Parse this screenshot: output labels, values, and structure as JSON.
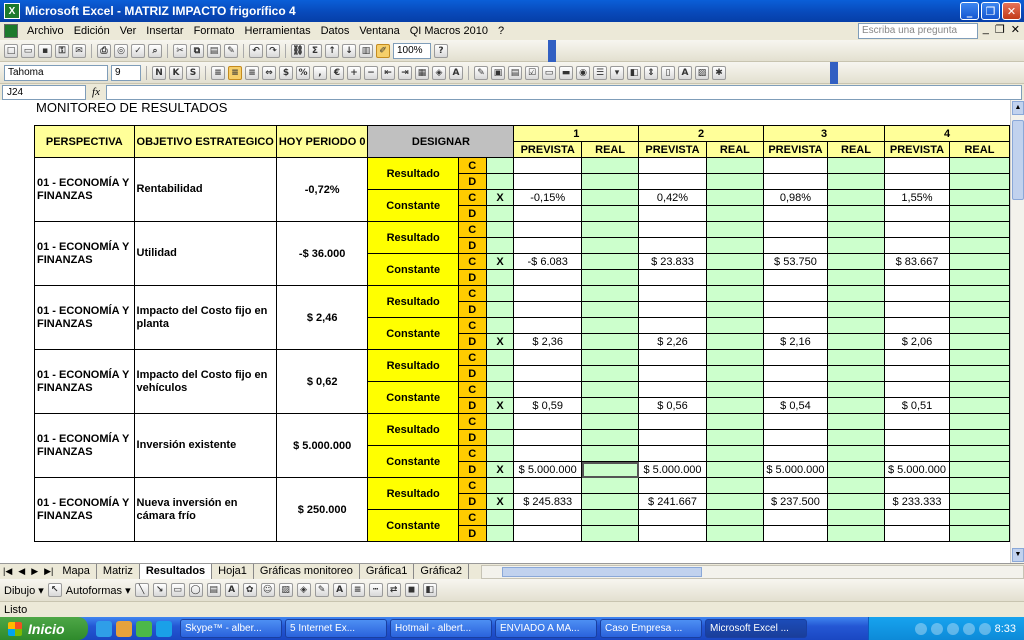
{
  "window": {
    "title": "Microsoft Excel - MATRIZ IMPACTO frigorífico 4"
  },
  "menu": {
    "items": [
      "Archivo",
      "Edición",
      "Ver",
      "Insertar",
      "Formato",
      "Herramientas",
      "Datos",
      "Ventana",
      "QI Macros 2010",
      "?"
    ],
    "help_placeholder": "Escriba una pregunta"
  },
  "toolbar": {
    "zoom": "100%",
    "font": "Tahoma",
    "font_size": "9"
  },
  "formula": {
    "cell_ref": "J24",
    "fx": "fx"
  },
  "sheet": {
    "title": "MONITOREO DE RESULTADOS",
    "headers": {
      "perspectiva": "PERSPECTIVA",
      "objetivo": "OBJETIVO ESTRATEGICO",
      "hoy": "HOY  PERIODO 0",
      "designar": "DESIGNAR",
      "periods": [
        "1",
        "2",
        "3",
        "4"
      ],
      "prevista": "PREVISTA",
      "real": "REAL"
    },
    "labels": {
      "resultado": "Resultado",
      "constante": "Constante",
      "c": "C",
      "d": "D",
      "x": "X"
    },
    "rows": [
      {
        "perspectiva": "01 - ECONOMÍA Y FINANZAS",
        "objetivo": "Rentabilidad",
        "hoy": "-0,72%",
        "mark_row": 2,
        "values": [
          "-0,15%",
          "0,42%",
          "0,98%",
          "1,55%"
        ]
      },
      {
        "perspectiva": "01 - ECONOMÍA Y FINANZAS",
        "objetivo": "Utilidad",
        "hoy": "-$ 36.000",
        "mark_row": 2,
        "values": [
          "-$ 6.083",
          "$ 23.833",
          "$ 53.750",
          "$ 83.667"
        ]
      },
      {
        "perspectiva": "01 - ECONOMÍA Y FINANZAS",
        "objetivo": "Impacto del Costo fijo en planta",
        "hoy": "$ 2,46",
        "mark_row": 3,
        "values": [
          "$ 2,36",
          "$ 2,26",
          "$ 2,16",
          "$ 2,06"
        ]
      },
      {
        "perspectiva": "01 - ECONOMÍA Y FINANZAS",
        "objetivo": "Impacto del Costo fijo en vehículos",
        "hoy": "$ 0,62",
        "mark_row": 3,
        "values": [
          "$ 0,59",
          "$ 0,56",
          "$ 0,54",
          "$ 0,51"
        ]
      },
      {
        "perspectiva": "01 - ECONOMÍA Y FINANZAS",
        "objetivo": "Inversión existente",
        "hoy": "$ 5.000.000",
        "mark_row": 3,
        "values": [
          "$ 5.000.000",
          "$ 5.000.000",
          "$ 5.000.000",
          "$ 5.000.000"
        ]
      },
      {
        "perspectiva": "01 - ECONOMÍA Y FINANZAS",
        "objetivo": "Nueva inversión en cámara frío",
        "hoy": "$ 250.000",
        "mark_row": 1,
        "values": [
          "$ 245.833",
          "$ 241.667",
          "$ 237.500",
          "$ 233.333"
        ]
      }
    ]
  },
  "tabs": {
    "items": [
      "Mapa",
      "Matriz",
      "Resultados",
      "Hoja1",
      "Gráficas monitoreo",
      "Gráfica1",
      "Gráfica2"
    ],
    "active": "Resultados"
  },
  "drawbar": {
    "dibujo": "Dibujo ▾",
    "autoformas": "Autoformas ▾"
  },
  "status": {
    "text": "Listo"
  },
  "taskbar": {
    "start": "Inicio",
    "tasks": [
      "Skype™ - alber...",
      "5 Internet Ex...",
      "Hotmail - albert...",
      "ENVIADO A MA...",
      "Caso Empresa ...",
      "Microsoft Excel ..."
    ],
    "time": "8:33"
  }
}
